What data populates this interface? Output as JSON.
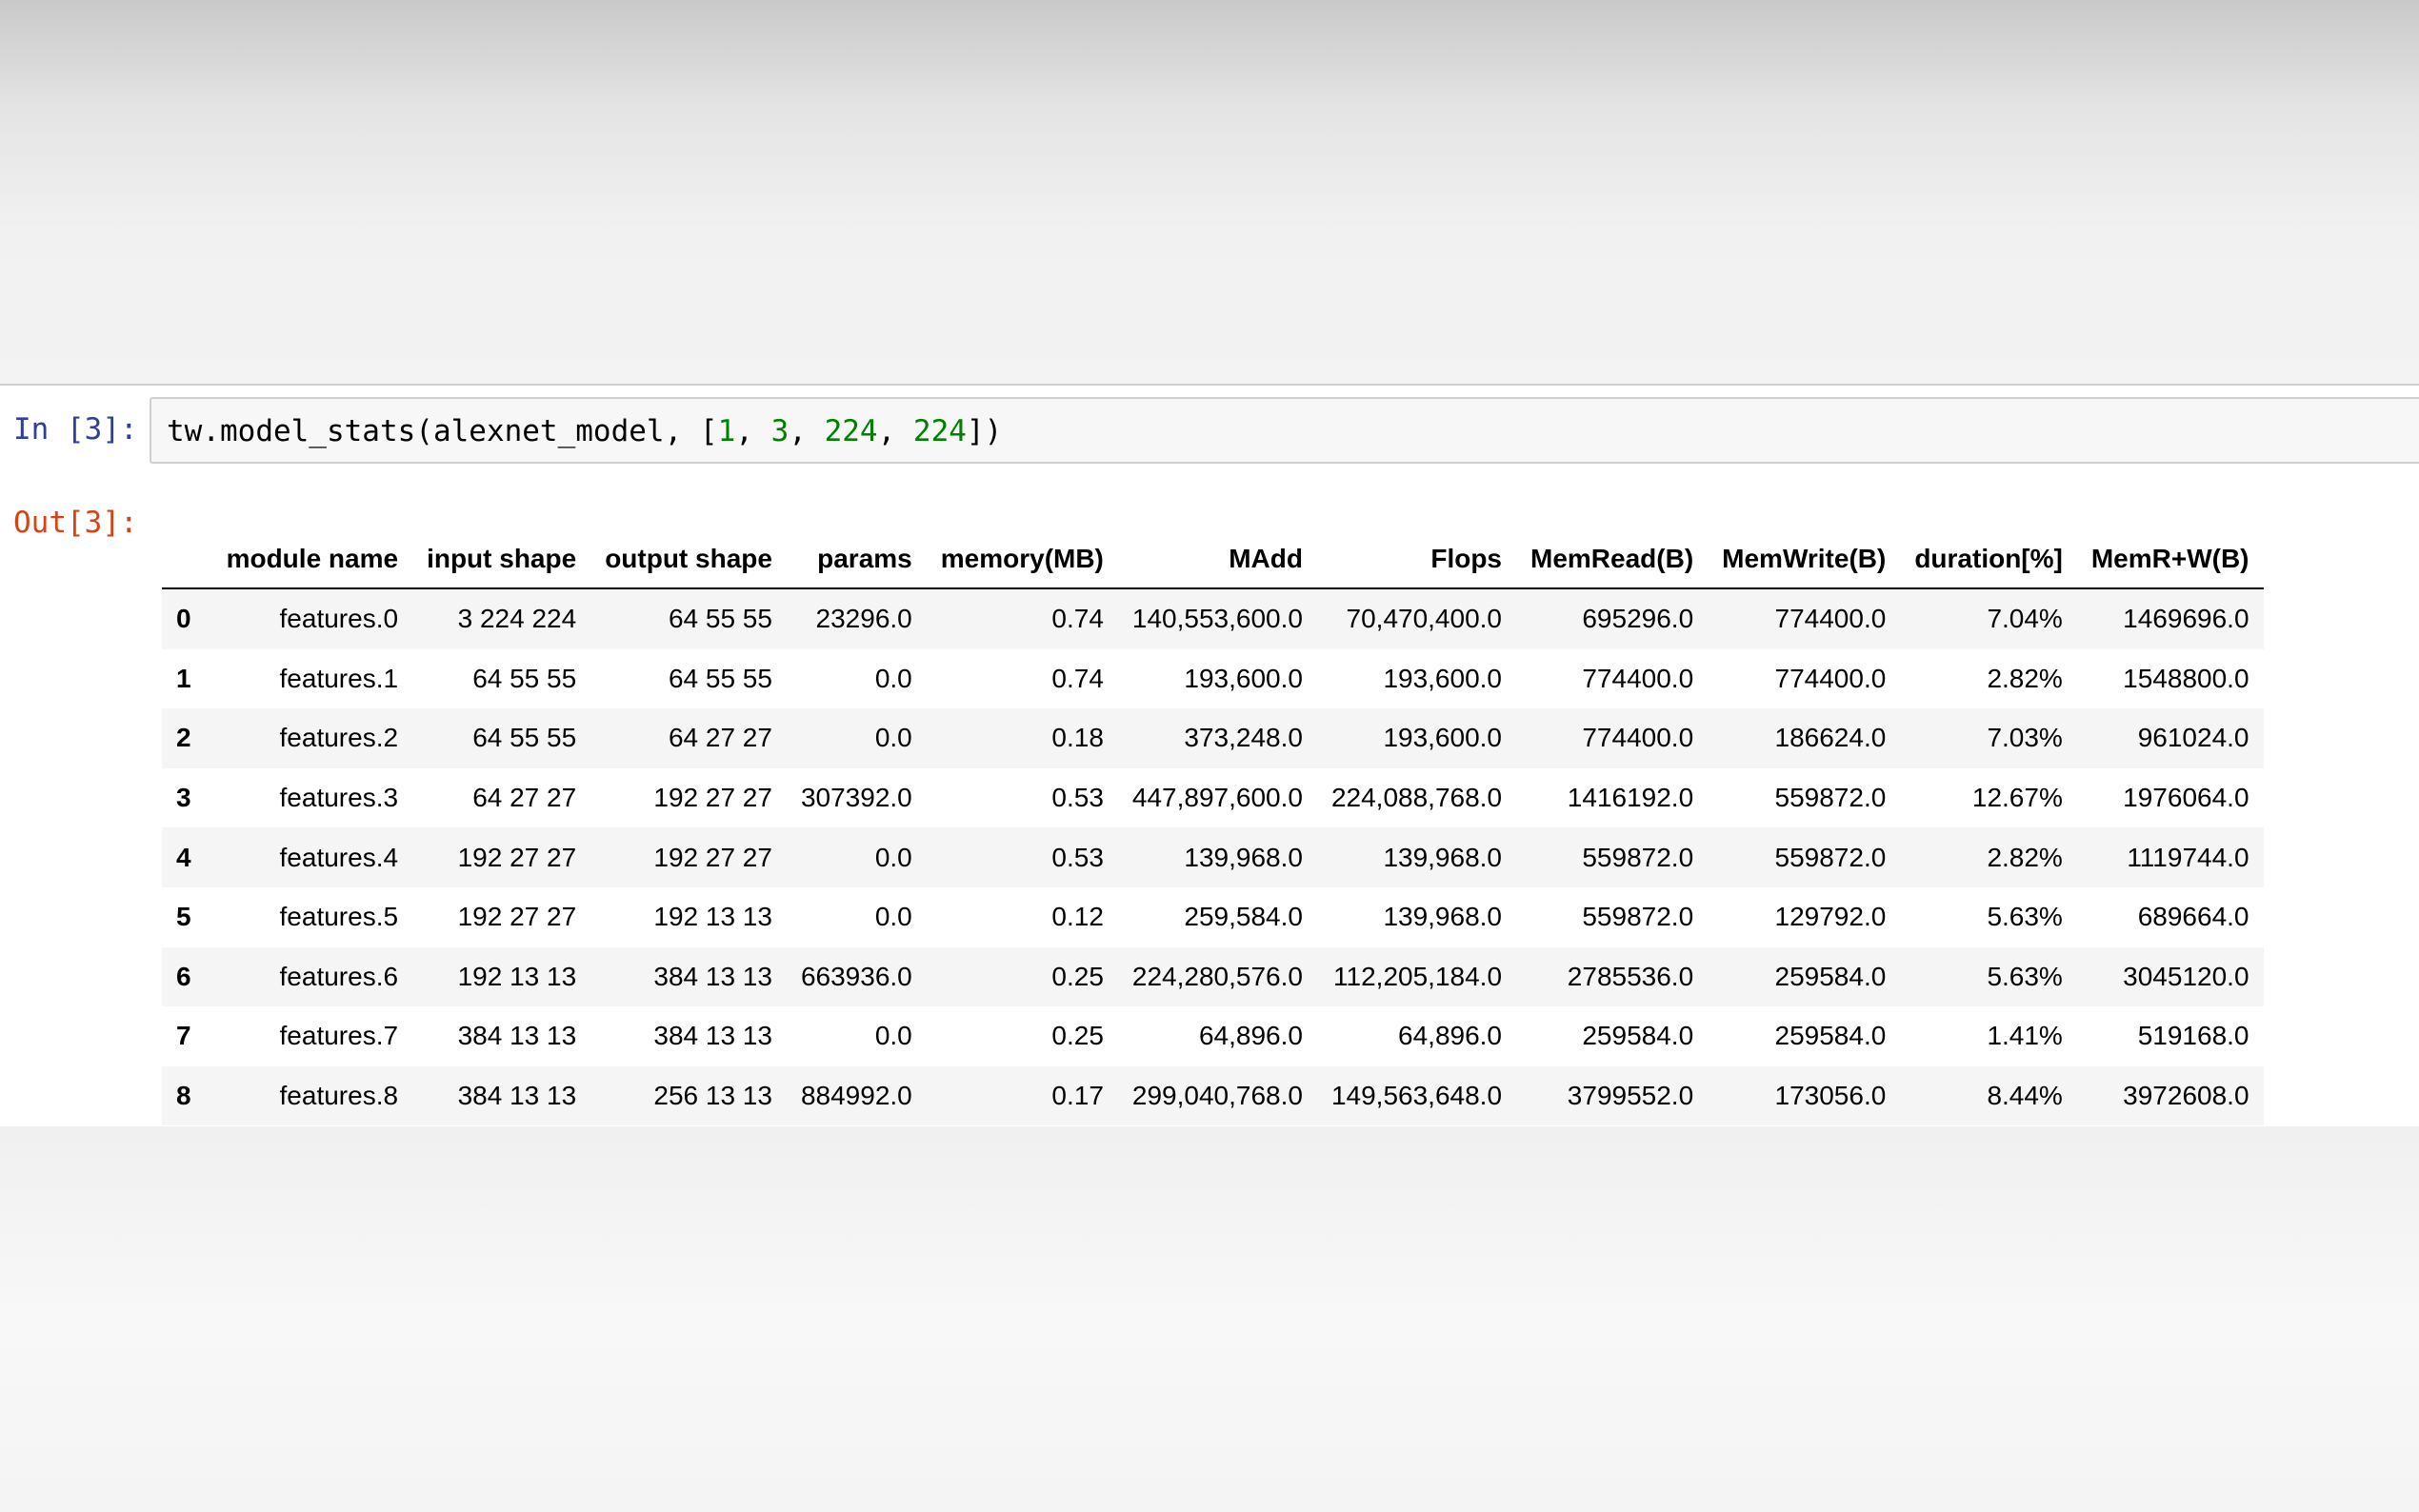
{
  "cell": {
    "in_prompt": "In [3]:",
    "out_prompt": "Out[3]:",
    "code": {
      "pre": "tw.model_stats(alexnet_model, [",
      "n1": "1",
      "sep1": ", ",
      "n2": "3",
      "sep2": ", ",
      "n3": "224",
      "sep3": ", ",
      "n4": "224",
      "post": "])"
    }
  },
  "table": {
    "columns": [
      "",
      "module name",
      "input shape",
      "output shape",
      "params",
      "memory(MB)",
      "MAdd",
      "Flops",
      "MemRead(B)",
      "MemWrite(B)",
      "duration[%]",
      "MemR+W(B)"
    ],
    "rows": [
      [
        "0",
        "features.0",
        "3 224 224",
        "64 55 55",
        "23296.0",
        "0.74",
        "140,553,600.0",
        "70,470,400.0",
        "695296.0",
        "774400.0",
        "7.04%",
        "1469696.0"
      ],
      [
        "1",
        "features.1",
        "64 55 55",
        "64 55 55",
        "0.0",
        "0.74",
        "193,600.0",
        "193,600.0",
        "774400.0",
        "774400.0",
        "2.82%",
        "1548800.0"
      ],
      [
        "2",
        "features.2",
        "64 55 55",
        "64 27 27",
        "0.0",
        "0.18",
        "373,248.0",
        "193,600.0",
        "774400.0",
        "186624.0",
        "7.03%",
        "961024.0"
      ],
      [
        "3",
        "features.3",
        "64 27 27",
        "192 27 27",
        "307392.0",
        "0.53",
        "447,897,600.0",
        "224,088,768.0",
        "1416192.0",
        "559872.0",
        "12.67%",
        "1976064.0"
      ],
      [
        "4",
        "features.4",
        "192 27 27",
        "192 27 27",
        "0.0",
        "0.53",
        "139,968.0",
        "139,968.0",
        "559872.0",
        "559872.0",
        "2.82%",
        "1119744.0"
      ],
      [
        "5",
        "features.5",
        "192 27 27",
        "192 13 13",
        "0.0",
        "0.12",
        "259,584.0",
        "139,968.0",
        "559872.0",
        "129792.0",
        "5.63%",
        "689664.0"
      ],
      [
        "6",
        "features.6",
        "192 13 13",
        "384 13 13",
        "663936.0",
        "0.25",
        "224,280,576.0",
        "112,205,184.0",
        "2785536.0",
        "259584.0",
        "5.63%",
        "3045120.0"
      ],
      [
        "7",
        "features.7",
        "384 13 13",
        "384 13 13",
        "0.0",
        "0.25",
        "64,896.0",
        "64,896.0",
        "259584.0",
        "259584.0",
        "1.41%",
        "519168.0"
      ],
      [
        "8",
        "features.8",
        "384 13 13",
        "256 13 13",
        "884992.0",
        "0.17",
        "299,040,768.0",
        "149,563,648.0",
        "3799552.0",
        "173056.0",
        "8.44%",
        "3972608.0"
      ]
    ]
  }
}
